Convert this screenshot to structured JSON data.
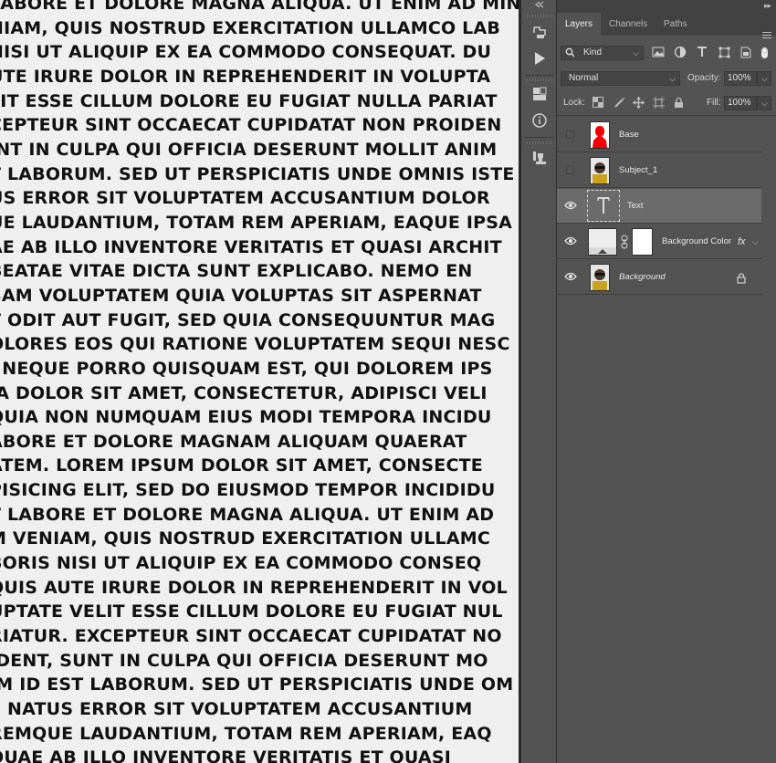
{
  "canvas": {
    "lines": [
      "LABORE ET DOLORE MAGNA ALIQUA. UT ENIM AD MIN",
      "NIAM, QUIS NOSTRUD EXERCITATION ULLAMCO LAB",
      "NISI UT ALIQUIP EX EA COMMODO CONSEQUAT. DU",
      "UTE IRURE DOLOR IN REPREHENDERIT IN VOLUPTA",
      "LIT ESSE CILLUM DOLORE EU FUGIAT NULLA PARIAT",
      "CEPTEUR SINT OCCAECAT CUPIDATAT NON PROIDEN",
      "INT IN CULPA QUI OFFICIA DESERUNT MOLLIT ANIM",
      "T LABORUM. SED UT PERSPICIATIS UNDE OMNIS ISTE",
      "US ERROR SIT VOLUPTATEM ACCUSANTIUM DOLOR",
      "UE LAUDANTIUM, TOTAM REM APERIAM, EAQUE IPSA",
      "AE AB ILLO INVENTORE VERITATIS ET QUASI ARCHIT",
      "BEATAE VITAE DICTA SUNT EXPLICABO. NEMO EN",
      "SAM VOLUPTATEM QUIA VOLUPTAS SIT ASPERNAT",
      "T ODIT AUT FUGIT, SED QUIA CONSEQUUNTUR MAG",
      "OLORES EOS QUI RATIONE VOLUPTATEM SEQUI NESC",
      ". NEQUE PORRO QUISQUAM EST, QUI DOLOREM IPS",
      "IA DOLOR SIT AMET, CONSECTETUR, ADIPISCI VELI",
      "QUIA NON NUMQUAM EIUS MODI TEMPORA INCIDU",
      "ABORE ET DOLORE MAGNAM ALIQUAM QUAERAT",
      "ATEM. LOREM IPSUM DOLOR SIT AMET, CONSECTE",
      "PISICING ELIT, SED DO EIUSMOD TEMPOR INCIDIDU",
      "T LABORE ET DOLORE MAGNA ALIQUA. UT ENIM AD",
      "M VENIAM, QUIS NOSTRUD EXERCITATION ULLAMC",
      "BORIS NISI UT ALIQUIP EX EA COMMODO CONSEQ",
      "QUIS AUTE IRURE DOLOR IN REPREHENDERIT IN VOL",
      "UPTATE VELIT ESSE CILLUM DOLORE EU FUGIAT NUL",
      "RIATUR. EXCEPTEUR SINT OCCAECAT CUPIDATAT NO",
      "IDENT, SUNT IN CULPA QUI OFFICIA DESERUNT MO",
      "IM ID EST LABORUM. SED UT PERSPICIATIS UNDE OM",
      "E NATUS ERROR SIT VOLUPTATEM ACCUSANTIUM",
      "REMQUE LAUDANTIUM, TOTAM REM APERIAM, EAQ",
      "QUAE AB ILLO INVENTORE VERITATIS ET QUASI"
    ]
  },
  "panel": {
    "tabs": [
      {
        "label": "Layers",
        "active": true
      },
      {
        "label": "Channels",
        "active": false
      },
      {
        "label": "Paths",
        "active": false
      }
    ],
    "filter": {
      "kind_label": "Kind",
      "search_icon": "search-icon"
    },
    "blend_mode": "Normal",
    "opacity_label": "Opacity:",
    "opacity_value": "100%",
    "lock_label": "Lock:",
    "fill_label": "Fill:",
    "fill_value": "100%",
    "layers": [
      {
        "name": "Base",
        "visible": false,
        "selected": false,
        "thumb": "red-figure"
      },
      {
        "name": "Subject_1",
        "visible": false,
        "selected": false,
        "thumb": "portrait"
      },
      {
        "name": "Text",
        "visible": true,
        "selected": true,
        "thumb": "type"
      },
      {
        "name": "Background Color",
        "visible": true,
        "selected": false,
        "thumb": "color-fill",
        "fx": "fx"
      },
      {
        "name": "Background",
        "visible": true,
        "selected": false,
        "thumb": "portrait",
        "italic": true,
        "locked": true
      }
    ]
  },
  "colors": {
    "panel_bg": "#535353",
    "tab_bar_bg": "#424242",
    "selected_row": "#6b6b6b",
    "canvas_bg": "#efefef",
    "canvas_text": "#111111"
  }
}
